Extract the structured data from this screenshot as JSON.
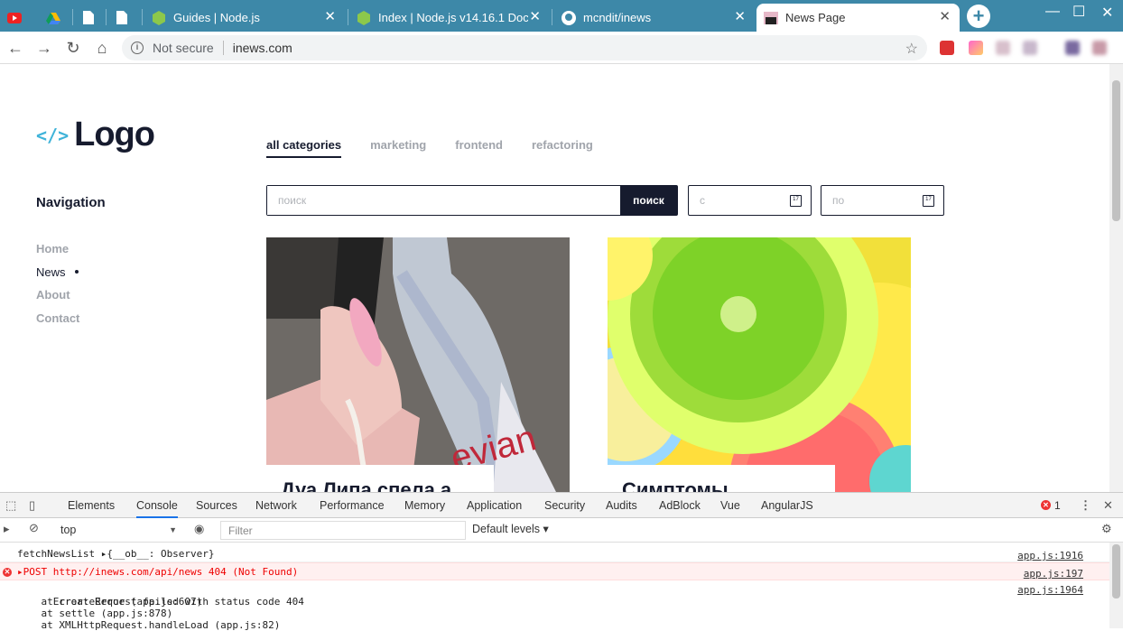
{
  "browser": {
    "tabs": [
      {
        "title": "",
        "icon": "youtube-icon"
      },
      {
        "title": "",
        "icon": "google-drive-icon"
      },
      {
        "title": "",
        "icon": "document-icon"
      },
      {
        "title": "",
        "icon": "document-icon"
      },
      {
        "title": "Guides | Node.js",
        "icon": "nodejs-icon"
      },
      {
        "title": "Index | Node.js v14.16.1 Doc",
        "icon": "nodejs-icon"
      },
      {
        "title": "mcndit/inews",
        "icon": "github-icon"
      },
      {
        "title": "News Page",
        "icon": "page-icon",
        "active": true
      }
    ],
    "new_tab_label": "+",
    "address": {
      "security": "Not secure",
      "url": "inews.com"
    },
    "colors": {
      "tabstrip": "#3d88a8"
    }
  },
  "site": {
    "logo_text": "Logo",
    "logo_mark": "</>",
    "categories": [
      "all categories",
      "marketing",
      "frontend",
      "refactoring"
    ],
    "active_category": "all categories",
    "navigation": {
      "title": "Navigation",
      "items": [
        "Home",
        "News",
        "About",
        "Contact"
      ],
      "active": "News"
    },
    "search": {
      "placeholder": "поиск",
      "button": "поиск"
    },
    "date_from": {
      "placeholder": "с",
      "icon": "calendar-icon",
      "day": "17"
    },
    "date_to": {
      "placeholder": "по",
      "icon": "calendar-icon",
      "day": "17"
    },
    "cards": [
      {
        "title": "Дуа Липа спела а",
        "image": "photo-water-bottle"
      },
      {
        "title": "Симптомы",
        "image": "photo-citrus-slices"
      }
    ]
  },
  "devtools": {
    "tabs": [
      "Elements",
      "Console",
      "Sources",
      "Network",
      "Performance",
      "Memory",
      "Application",
      "Security",
      "Audits",
      "AdBlock",
      "Vue",
      "AngularJS"
    ],
    "active_tab": "Console",
    "error_count": "1",
    "context": "top",
    "filter_placeholder": "Filter",
    "levels": "Default levels ▾",
    "console": [
      {
        "text": "fetchNewsList ▸{__ob__: Observer}",
        "source": "app.js:1916",
        "type": "log"
      },
      {
        "text": "▸POST http://inews.com/api/news 404 (Not Found)",
        "source": "app.js:197",
        "type": "error"
      },
      {
        "text": "Error: Request failed with status code 404",
        "source": "app.js:1964",
        "type": "log"
      },
      {
        "text": "    at createError (app.js:607)",
        "source": "",
        "type": "log"
      },
      {
        "text": "    at settle (app.js:878)",
        "source": "",
        "type": "log"
      },
      {
        "text": "    at XMLHttpRequest.handleLoad (app.js:82)",
        "source": "",
        "type": "log"
      }
    ]
  }
}
